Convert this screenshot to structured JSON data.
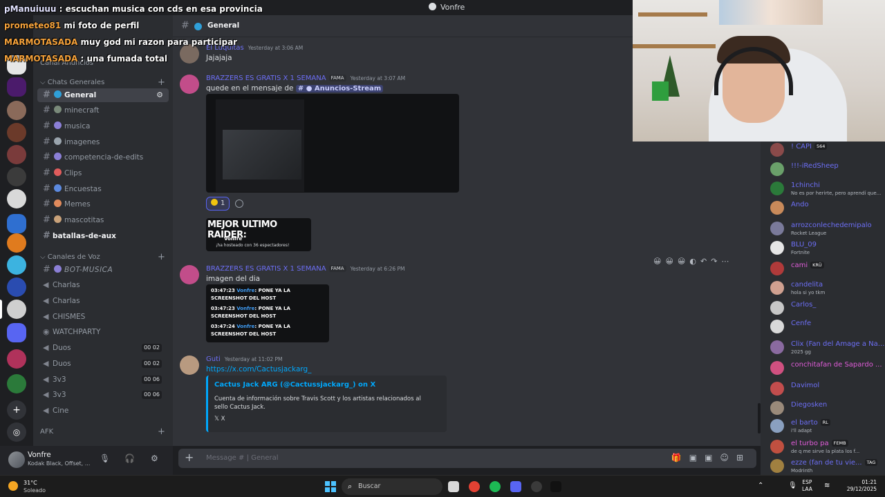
{
  "window": {
    "title": "Vonfre"
  },
  "overlay_chat": [
    {
      "user": "pManuiuuu",
      "text": " : escuchan musica con cds en esa provincia"
    },
    {
      "user": "prometeo81",
      "text": " mi foto de perfil"
    },
    {
      "user": "MARMOTASADA",
      "text": " muy god mi razon para participar"
    },
    {
      "user": "MARMOTASADA",
      "text": " : una fumada total"
    }
  ],
  "sidebar": {
    "category_top": "Canal Anuncios",
    "category_chats": "Chats Generales",
    "category_voice": "Canales de Voz",
    "category_afk": "AFK",
    "text_channels": [
      {
        "label": "General",
        "active": true
      },
      {
        "label": "minecraft"
      },
      {
        "label": "musica"
      },
      {
        "label": "imagenes"
      },
      {
        "label": "competencia-de-edits"
      },
      {
        "label": "Clips"
      },
      {
        "label": "Encuestas"
      },
      {
        "label": "Memes"
      },
      {
        "label": "mascotitas"
      },
      {
        "label": "batallas-de-aux"
      }
    ],
    "voice_channels": [
      {
        "label": "BOT-MUSICA"
      },
      {
        "label": "Charlas"
      },
      {
        "label": "Charlas"
      },
      {
        "label": "CHISMES"
      },
      {
        "label": "WATCHPARTY"
      },
      {
        "label": "Duos",
        "count": "00 02"
      },
      {
        "label": "Duos",
        "count": "00 02"
      },
      {
        "label": "3v3",
        "count": "00 06"
      },
      {
        "label": "3v3",
        "count": "00 06"
      },
      {
        "label": "Cine"
      }
    ]
  },
  "user_panel": {
    "name": "Vonfre",
    "status": "Kodak Black, Offset, ..."
  },
  "channel_header": {
    "name": "General"
  },
  "messages": [
    {
      "author": "El Luquitas",
      "time": "Yesterday at 3:06 AM",
      "text": "Jajajaja"
    },
    {
      "author": "BRAZZERS ES GRATIS X 1 SEMANA",
      "tag": "FAMA",
      "time": "Yesterday at 3:07 AM",
      "text": "quede en el mensaje de",
      "mention": "Anuncios-Stream"
    },
    {
      "author": "BRAZZERS ES GRATIS X 1 SEMANA",
      "tag": "FAMA",
      "time": "Yesterday at 6:26 PM",
      "text": "imagen del dia"
    },
    {
      "author": "Guti",
      "time": "Yesterday at 11:02 PM",
      "link": "https://x.com/Cactusjackarg_"
    }
  ],
  "reaction": {
    "count": "1"
  },
  "raider_card": {
    "heading": "MEJOR ULTIMO RAIDER:",
    "name": "Vonfre",
    "text": "¡ha hosteado con 36 espectadores!"
  },
  "log_lines": [
    {
      "time": "03:47:23",
      "user": "Vonfre",
      "text": ": PONE YA LA SCREENSHOT DEL HOST"
    },
    {
      "time": "03:47:23",
      "user": "Vonfre",
      "text": ": PONE YA LA SCREENSHOT DEL HOST"
    },
    {
      "time": "03:47:24",
      "user": "Vonfre",
      "text": ": PONE YA LA SCREENSHOT DEL HOST"
    }
  ],
  "embed": {
    "title": "Cactus Jack ARG (@Cactussjackarg_) on X",
    "description": "Cuenta de información sobre Travis Scott y los artistas relacionados al sello Cactus Jack.",
    "footer": "X"
  },
  "composer": {
    "placeholder": "Message #  | General"
  },
  "members": [
    {
      "name": "! CAPI",
      "badge": "564",
      "color": "#6d6ff7",
      "status": ""
    },
    {
      "name": "!!!-iRedSheep",
      "badge": "",
      "color": "#6d6ff7",
      "status": ""
    },
    {
      "name": "1chinchi",
      "badge": "",
      "color": "#6d6ff7",
      "status": "No es por herirte, pero aprendí que..."
    },
    {
      "name": "Ando",
      "badge": "",
      "color": "#6d6ff7",
      "status": ""
    },
    {
      "name": "arrozconlechedemipalo",
      "badge": "",
      "color": "#6d6ff7",
      "status": "Rocket League"
    },
    {
      "name": "BLU_09",
      "badge": "",
      "color": "#6d6ff7",
      "status": "Fortnite"
    },
    {
      "name": "cami",
      "badge": "KRÜ",
      "color": "#e05cd9",
      "status": ""
    },
    {
      "name": "candelita",
      "badge": "",
      "color": "#6d6ff7",
      "status": "hola si yo tkm"
    },
    {
      "name": "Carlos_",
      "badge": "",
      "color": "#6d6ff7",
      "status": ""
    },
    {
      "name": "Cenfe",
      "badge": "",
      "color": "#6d6ff7",
      "status": ""
    },
    {
      "name": "Clix (Fan del Amage a Na...",
      "badge": "",
      "color": "#6d6ff7",
      "status": "2025 gg"
    },
    {
      "name": "conchitafan de Sapardo ...",
      "badge": "",
      "color": "#e05cd9",
      "status": ""
    },
    {
      "name": "Davimol",
      "badge": "",
      "color": "#6d6ff7",
      "status": ""
    },
    {
      "name": "Diegosken",
      "badge": "",
      "color": "#6d6ff7",
      "status": ""
    },
    {
      "name": "el barto",
      "badge": "RL",
      "color": "#6d6ff7",
      "status": "i'll adapt"
    },
    {
      "name": "el turbo pa",
      "badge": "FEMB",
      "color": "#e05cd9",
      "status": "de q me sirve la plata los f..."
    },
    {
      "name": "ezze (fan de tu vie...",
      "badge": "TAG",
      "color": "#6d6ff7",
      "status": "Modrinth"
    }
  ],
  "taskbar": {
    "weather_temp": "31°C",
    "weather_desc": "Soleado",
    "search": "Buscar",
    "lang1": "ESP",
    "lang2": "LAA",
    "time": "01:21",
    "date": "29/12/2025"
  },
  "colors": {
    "accent": "#5865f2",
    "link": "#00a8fc",
    "bg": "#313338"
  }
}
